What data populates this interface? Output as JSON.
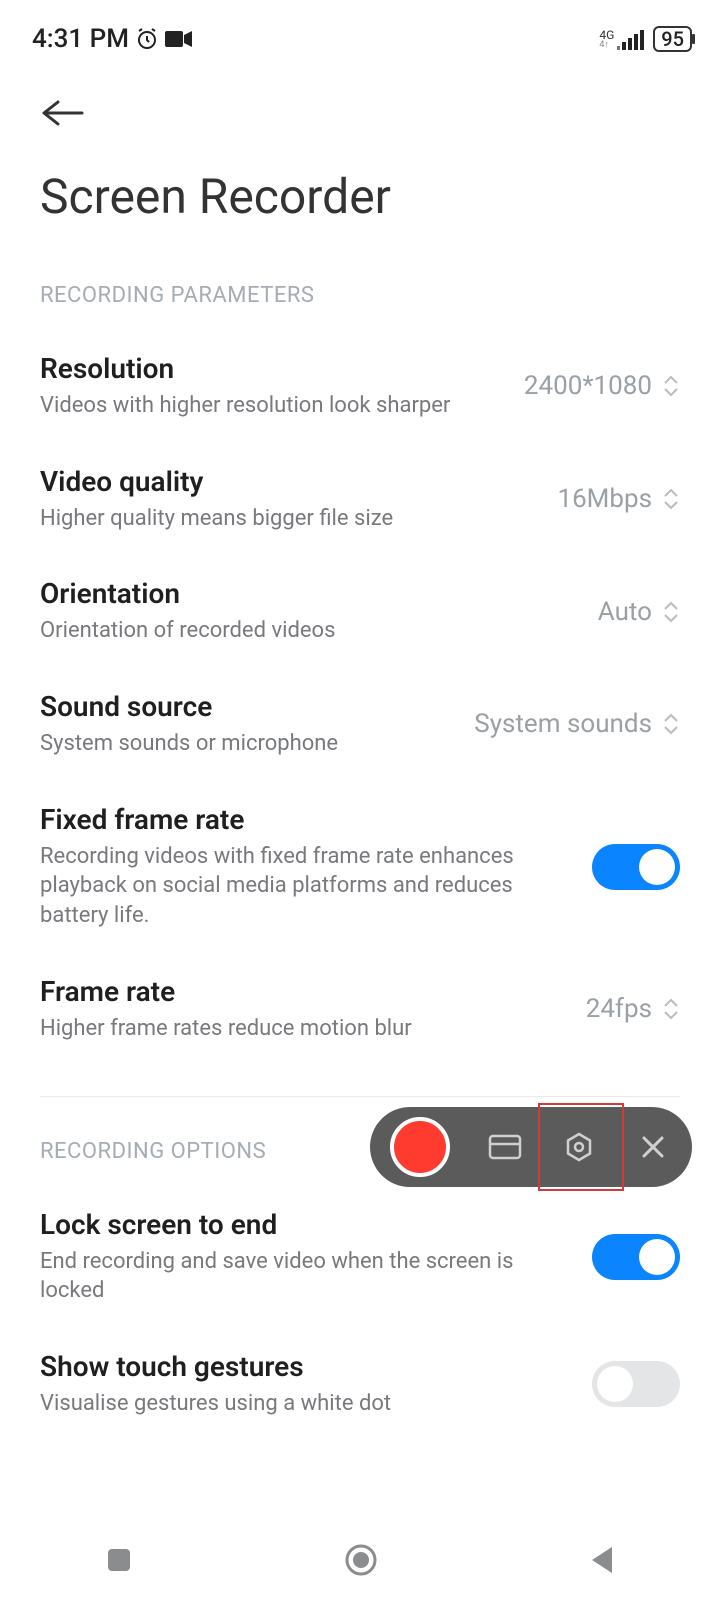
{
  "status": {
    "time": "4:31 PM",
    "network": "4G",
    "battery": "95"
  },
  "page": {
    "title": "Screen Recorder"
  },
  "sections": {
    "params_head": "RECORDING PARAMETERS",
    "options_head": "RECORDING OPTIONS"
  },
  "settings": {
    "resolution": {
      "label": "Resolution",
      "desc": "Videos with higher resolution look sharper",
      "value": "2400*1080"
    },
    "quality": {
      "label": "Video quality",
      "desc": "Higher quality means bigger file size",
      "value": "16Mbps"
    },
    "orientation": {
      "label": "Orientation",
      "desc": "Orientation of recorded videos",
      "value": "Auto"
    },
    "sound": {
      "label": "Sound source",
      "desc": "System sounds or microphone",
      "value": "System sounds"
    },
    "fixedframe": {
      "label": "Fixed frame rate",
      "desc": "Recording videos with fixed frame rate enhances playback on social media platforms and reduces battery life.",
      "on": true
    },
    "framerate": {
      "label": "Frame rate",
      "desc": "Higher frame rates reduce motion blur",
      "value": "24fps"
    },
    "lockend": {
      "label": "Lock screen to end",
      "desc": "End recording and save video when the screen is locked",
      "on": true
    },
    "gestures": {
      "label": "Show touch gestures",
      "desc": "Visualise gestures using a white dot",
      "on": false
    }
  }
}
